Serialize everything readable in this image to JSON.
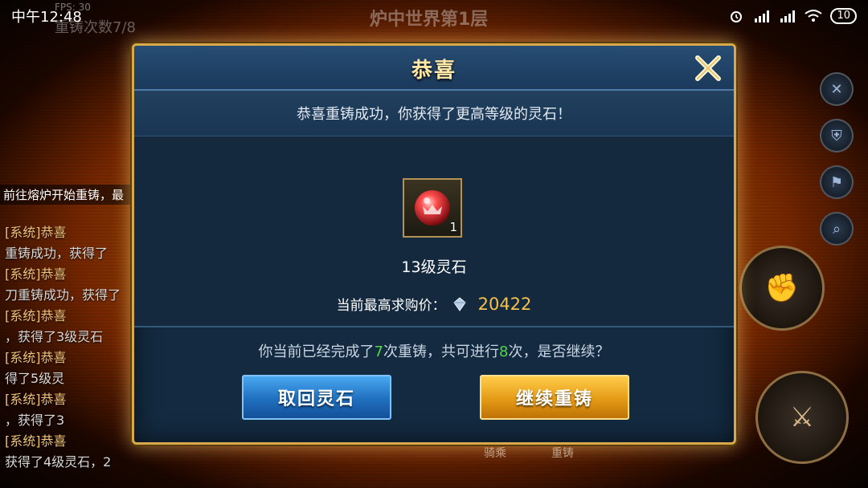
{
  "statusbar": {
    "time": "中午12:48",
    "battery": "10"
  },
  "background": {
    "floor_title": "炉中世界第1层",
    "fps": "FPS: 30",
    "recast_count": "重铸次数7/8",
    "chat_hint": "前往熔炉开始重铸，最",
    "chat_lines": [
      "[系统]恭喜",
      "重铸成功，获得了",
      "[系统]恭喜",
      "刀重铸成功，获得了",
      "[系统]恭喜",
      "，获得了3级灵石",
      "[系统]恭喜",
      "得了5级灵",
      "[系统]恭喜",
      "，获得了3",
      "[系统]恭喜",
      "获得了4级灵石，2"
    ],
    "bottom_labels": [
      "骑乘",
      "重铸"
    ]
  },
  "dialog": {
    "title": "恭喜",
    "subtitle": "恭喜重铸成功，你获得了更高等级的灵石！",
    "item": {
      "name": "13级灵石",
      "count": "1"
    },
    "price_label": "当前最高求购价：",
    "price_value": "20422",
    "progress": {
      "prefix": "你当前已经完成了",
      "done": "7",
      "middle": "次重铸，共可进行",
      "total": "8",
      "suffix": "次，是否继续？"
    },
    "retrieve_button": "取回灵石",
    "continue_button": "继续重铸"
  }
}
